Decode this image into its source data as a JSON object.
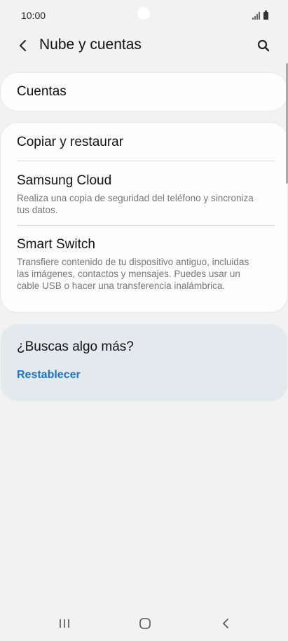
{
  "status_bar": {
    "time": "10:00"
  },
  "header": {
    "title": "Nube y cuentas",
    "back_icon": "chevron-left-icon",
    "search_icon": "search-icon"
  },
  "accounts_card": {
    "title": "Cuentas"
  },
  "backup_card": {
    "items": [
      {
        "title": "Copiar y restaurar",
        "description": ""
      },
      {
        "title": "Samsung Cloud",
        "description": "Realiza una copia de seguridad del teléfono y sincroniza tus datos."
      },
      {
        "title": "Smart Switch",
        "description": "Transfiere contenido de tu dispositivo antiguo, incluidas las imágenes, contactos y mensajes. Puedes usar un cable USB o hacer una transferencia inalámbrica."
      }
    ]
  },
  "more_card": {
    "title": "¿Buscas algo más?",
    "link": "Restablecer"
  },
  "nav_bar": {
    "recent_icon": "recent-apps-icon",
    "home_icon": "home-icon",
    "back_icon": "back-icon"
  },
  "colors": {
    "background": "#f2f2f2",
    "card": "#fdfdfd",
    "more_card": "#e4e9ee",
    "link": "#1a73c6"
  }
}
